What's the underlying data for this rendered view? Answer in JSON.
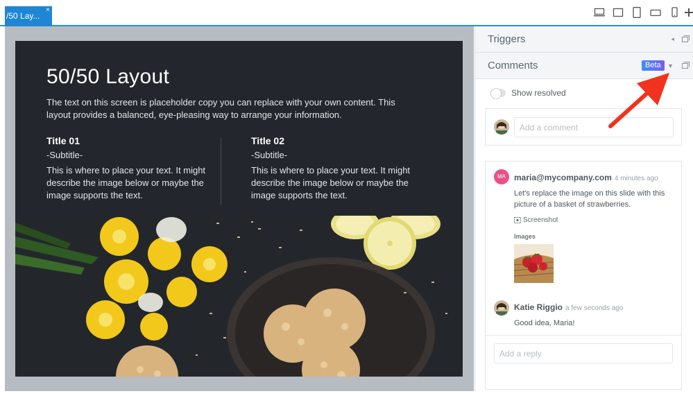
{
  "tab": {
    "label": "/50 Lay...",
    "close": "×"
  },
  "device_icons": [
    "desktop-icon",
    "laptop-icon",
    "tablet-portrait-icon",
    "tablet-landscape-icon",
    "phone-icon",
    "plus-icon"
  ],
  "slide": {
    "title": "50/50 Layout",
    "description": "The text on this screen is placeholder copy you can replace with your own content. This layout provides a balanced, eye-pleasing way to arrange your information.",
    "columns": [
      {
        "title": "Title 01",
        "subtitle": "-Subtitle-",
        "body": "This is where to place your text. It might describe the image below or maybe the image supports the text."
      },
      {
        "title": "Title 02",
        "subtitle": "-Subtitle-",
        "body": "This is where to place your text. It might describe the image below or maybe the image supports the text."
      }
    ]
  },
  "panel": {
    "triggers": {
      "title": "Triggers"
    },
    "comments": {
      "title": "Comments",
      "badge": "Beta"
    },
    "show_resolved": "Show resolved",
    "new_comment_placeholder": "Add a comment",
    "thread": {
      "comment1": {
        "avatar_initials": "MA",
        "author": "maria@mycompany.com",
        "time": "4 minutes ago",
        "text": "Let's replace the image on this slide with this picture of a basket of strawberries.",
        "screenshot_label": "Screenshot",
        "images_label": "Images"
      },
      "comment2": {
        "author": "Katie Riggio",
        "time": "a few seconds ago",
        "text": "Good idea, Maria!"
      },
      "reply_placeholder": "Add a reply"
    }
  },
  "colors": {
    "accent": "#1e86d4",
    "beta_start": "#3f8ef5",
    "beta_end": "#7a5cf0",
    "arrow": "#f0321e",
    "slide_bg": "#23272d",
    "maria_avatar": "#e8508a"
  }
}
